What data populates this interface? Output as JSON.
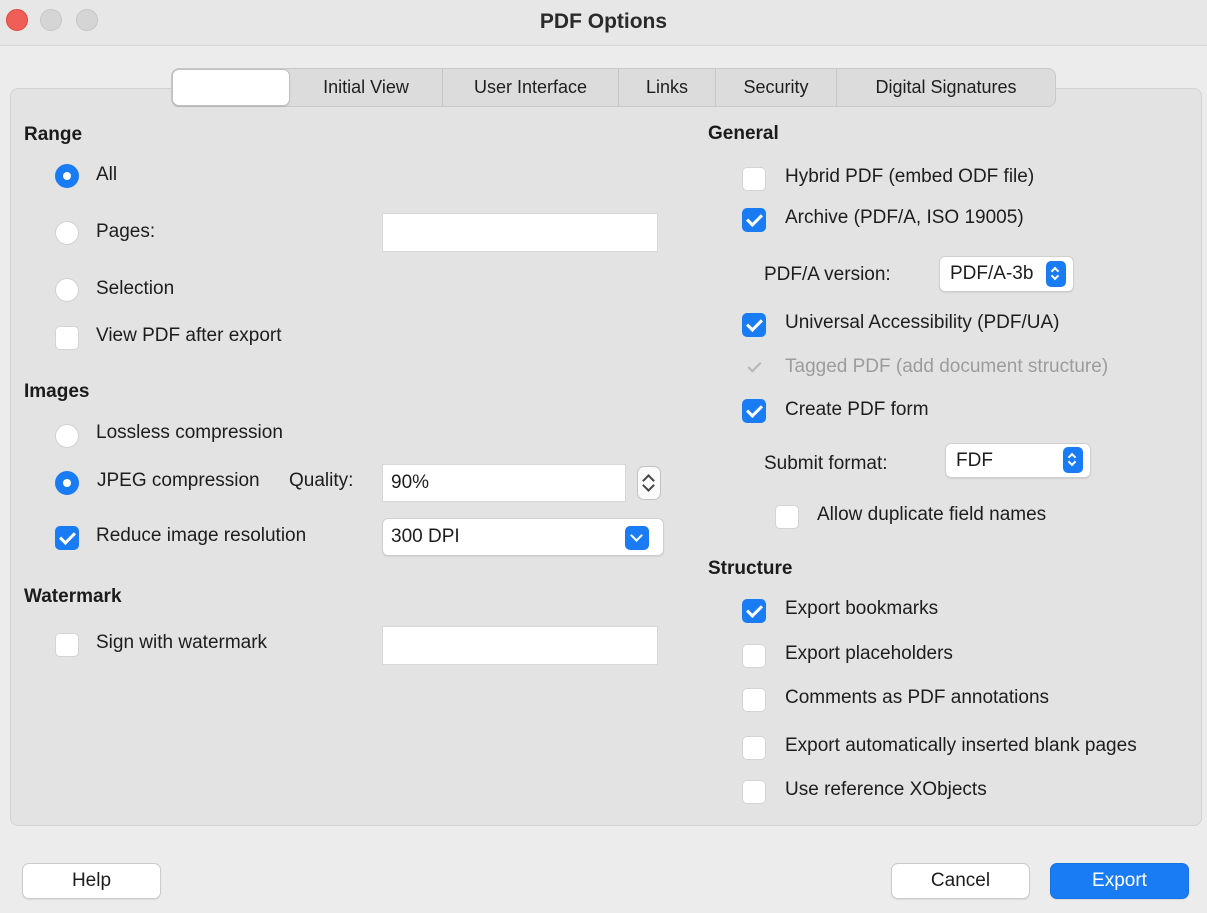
{
  "window": {
    "title": "PDF Options"
  },
  "tabs": [
    {
      "label": ""
    },
    {
      "label": "Initial View"
    },
    {
      "label": "User Interface"
    },
    {
      "label": "Links"
    },
    {
      "label": "Security"
    },
    {
      "label": "Digital Signatures"
    }
  ],
  "range": {
    "title": "Range",
    "all": "All",
    "pages": "Pages:",
    "pages_value": "",
    "selection": "Selection",
    "view_after": "View PDF after export"
  },
  "images": {
    "title": "Images",
    "lossless": "Lossless compression",
    "jpeg": "JPEG compression",
    "quality_label": "Quality:",
    "quality_value": "90%",
    "reduce": "Reduce image resolution",
    "resolution_value": "300 DPI"
  },
  "watermark": {
    "title": "Watermark",
    "sign": "Sign with watermark",
    "watermark_value": ""
  },
  "general": {
    "title": "General",
    "hybrid": "Hybrid PDF (embed ODF file)",
    "archive": "Archive (PDF/A, ISO 19005)",
    "pdfa_label": "PDF/A version:",
    "pdfa_value": "PDF/A-3b",
    "ua": "Universal Accessibility (PDF/UA)",
    "tagged": "Tagged PDF (add document structure)",
    "form": "Create PDF form",
    "submit_label": "Submit format:",
    "submit_value": "FDF",
    "duplicate": "Allow duplicate field names"
  },
  "structure": {
    "title": "Structure",
    "bookmarks": "Export bookmarks",
    "placeholders": "Export placeholders",
    "comments": "Comments as PDF annotations",
    "blank_pages": "Export automatically inserted blank pages",
    "xobjects": "Use reference XObjects"
  },
  "buttons": {
    "help": "Help",
    "cancel": "Cancel",
    "export": "Export"
  },
  "colors": {
    "accent": "#1a7cf5",
    "close": "#ef5f58"
  }
}
